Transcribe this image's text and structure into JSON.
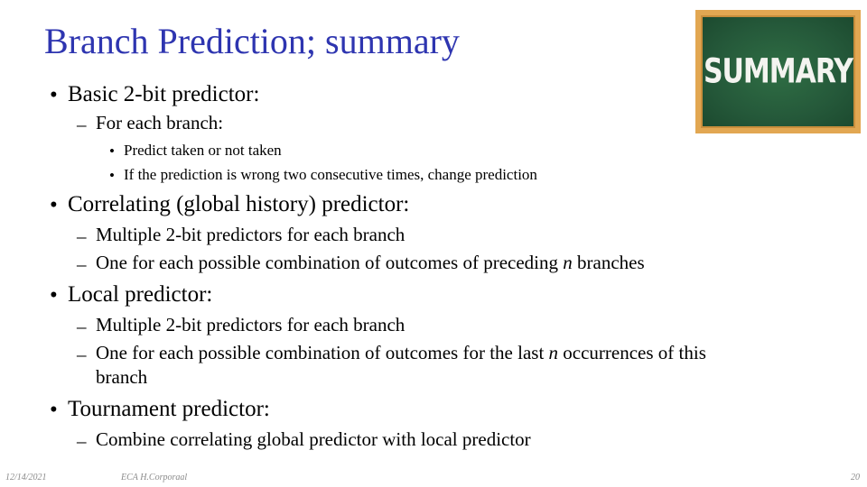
{
  "slide": {
    "title": "Branch Prediction; summary",
    "image": {
      "icon": "chalkboard-icon",
      "text": "SUMMARY"
    },
    "bullets": [
      {
        "text": "Basic 2-bit predictor:",
        "sub": [
          {
            "text": "For each branch:",
            "sub": [
              "Predict taken or not taken",
              "If the prediction is wrong two consecutive times, change prediction"
            ]
          }
        ]
      },
      {
        "text": "Correlating (global history) predictor:",
        "sub": [
          {
            "text": "Multiple 2-bit predictors for each branch"
          },
          {
            "text_before": "One for each possible combination of outcomes of preceding ",
            "italic": "n",
            "text_after": " branches"
          }
        ]
      },
      {
        "text": "Local predictor:",
        "sub": [
          {
            "text": "Multiple 2-bit predictors for each branch"
          },
          {
            "text_before": "One for each possible combination of outcomes for the last ",
            "italic": "n",
            "text_after": " occurrences of this",
            "continuation": "branch"
          }
        ]
      },
      {
        "text": "Tournament predictor:",
        "sub": [
          {
            "text": "Combine correlating global predictor with local predictor"
          }
        ]
      }
    ],
    "markers": {
      "l1": "•",
      "l2": "–",
      "l3": "•"
    }
  },
  "footer": {
    "date": "12/14/2021",
    "author": "ECA  H.Corporaal",
    "page": "20"
  }
}
